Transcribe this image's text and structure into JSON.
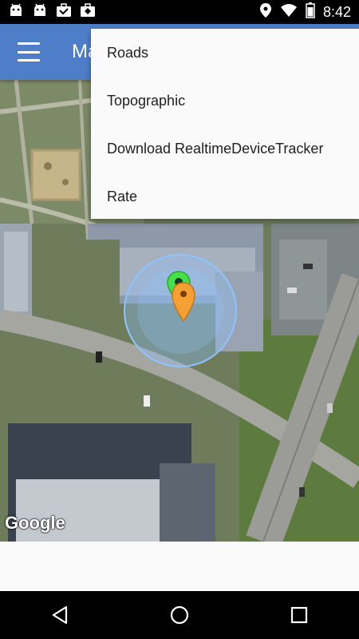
{
  "status_bar": {
    "time": "8:42",
    "left_icons": [
      "android-icon",
      "android-icon",
      "briefcase-icon",
      "briefcase-icon"
    ],
    "right_icons": [
      "location-pin-icon",
      "wifi-icon",
      "battery-icon"
    ]
  },
  "app_bar": {
    "title": "Ma"
  },
  "menu": {
    "items": [
      {
        "label": "Roads"
      },
      {
        "label": "Topographic"
      },
      {
        "label": "Download RealtimeDeviceTracker"
      },
      {
        "label": "Rate"
      }
    ]
  },
  "map": {
    "attribution": "Google",
    "markers": [
      "green-marker",
      "orange-marker"
    ],
    "accuracy_circle_color": "#8fc3ff",
    "green_marker_color": "#46e04a",
    "orange_marker_color": "#f5a033"
  },
  "colors": {
    "app_bar": "#4f7ec9",
    "status_bar": "#000000",
    "nav_bar": "#000000"
  }
}
